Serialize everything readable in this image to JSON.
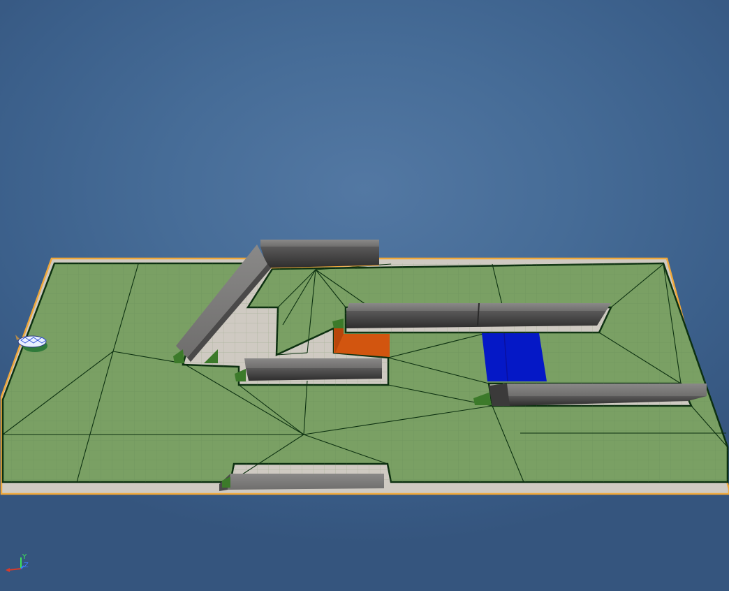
{
  "viewport": {
    "background_color": "#466c97",
    "ground_color": "#7aa064",
    "navmesh_edge_color": "#0c3010",
    "selection_outline_color": "#f0a83a",
    "walkway_color": "#c9c4bc",
    "wall_color": "#6b6a6a"
  },
  "objects": {
    "orange_volume": {
      "color": "#d2550f"
    },
    "blue_volume": {
      "color": "#0518c6"
    },
    "player_start_icon": "player-start-icon"
  },
  "axis_gizmo": {
    "y_label": "Y",
    "z_label": "Z",
    "x_color": "#d83a2a",
    "y_color": "#3ee35a",
    "z_color": "#3a7bff"
  }
}
